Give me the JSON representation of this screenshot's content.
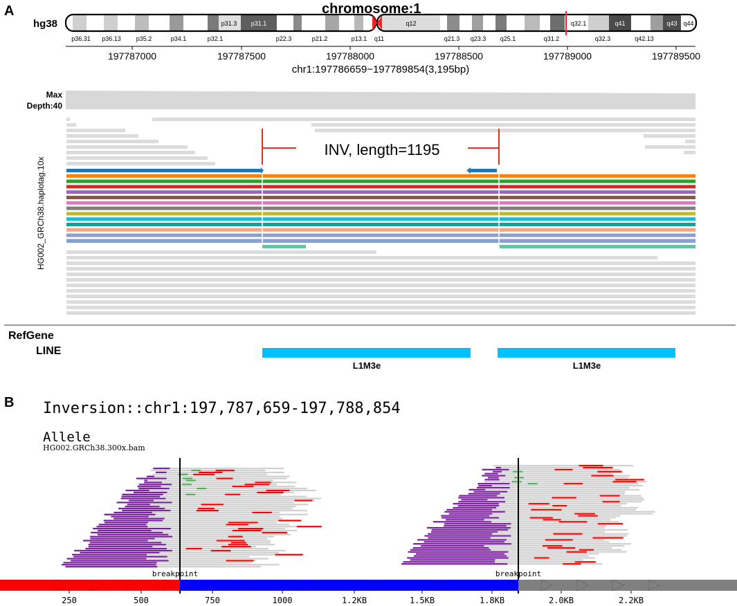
{
  "panel_a": {
    "label": "A",
    "genome": "hg38",
    "chromosome_title": "chromosome:1",
    "bands_p": [
      "p36.31",
      "p36.13",
      "p35.2",
      "p34.1",
      "p32.1",
      "p31.3",
      "p31.1",
      "p22.3",
      "p21.2",
      "p13.1"
    ],
    "bands_q": [
      "q11",
      "q21.3",
      "q23.3",
      "q25.1",
      "q31.2",
      "q32.3",
      "q42.13"
    ],
    "band_inside_labels": [
      "p31.3",
      "p31.1",
      "q12",
      "q32.1",
      "q41",
      "q43",
      "q44"
    ],
    "ruler_ticks": [
      "197787000",
      "197787500",
      "197788000",
      "197788500",
      "197789000",
      "197789500"
    ],
    "region": "chr1:197786659−197789854(3,195bp)",
    "depth_label_1": "Max",
    "depth_label_2": "Depth:40",
    "track_name": "HG002_GRCh38.haplotag.10x",
    "sv_label": "INV, length=1195",
    "refgene_title": "RefGene",
    "line_track": "LINE",
    "gene_1": "L1M3e",
    "gene_2": "L1M3e",
    "colors": {
      "depth": "#d8d8d8",
      "gray_read": "#dcdcdc",
      "sv_marker": "#d4381c",
      "gene": "#00bfff",
      "centromere": "#ff2222"
    },
    "colored_reads": [
      "#1f77b4",
      "#ff7f0e",
      "#2ca02c",
      "#d62728",
      "#9467bd",
      "#8c564b",
      "#e377c2",
      "#7f7f7f",
      "#bcbd22",
      "#17becf",
      "#1a9e8f",
      "#f4a582",
      "#8da0cb",
      "#66c2a5"
    ]
  },
  "panel_b": {
    "label": "B",
    "title": "Inversion::chr1:197,787,659-197,788,854",
    "subtitle": "Allele",
    "bam": "HG002.GRCh38.300x.bam",
    "breakpoint_label_1": "breakpoint",
    "breakpoint_label_2": "breakpoint",
    "axis_ticks": [
      "250",
      "500",
      "750",
      "1000",
      "1.2KB",
      "1.5KB",
      "1.8KB",
      "2.0KB",
      "2.2KB"
    ],
    "colors": {
      "left_flank": "#ff0000",
      "inverted": "#0000ff",
      "right_flank": "#808080",
      "clip_left": "#7b1fa2",
      "clip_right": "#ff0000",
      "mismatch": "#4caf50",
      "read": "#d0d0d0"
    }
  }
}
